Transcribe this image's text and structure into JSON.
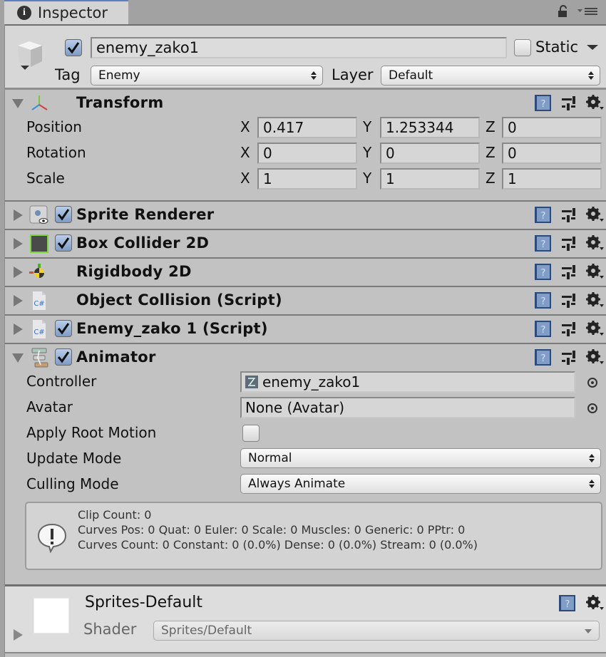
{
  "tab": {
    "title": "Inspector",
    "icon": "info-icon"
  },
  "tab_controls": {
    "lock": "lock-icon",
    "menu": "tab-menu-icon"
  },
  "gameobject": {
    "active": true,
    "name": "enemy_zako1",
    "static_label": "Static",
    "static": false,
    "tag_label": "Tag",
    "tag_value": "Enemy",
    "layer_label": "Layer",
    "layer_value": "Default"
  },
  "transform": {
    "title": "Transform",
    "expanded": true,
    "rows": [
      {
        "label": "Position",
        "x": "0.417",
        "y": "1.253344",
        "z": "0"
      },
      {
        "label": "Rotation",
        "x": "0",
        "y": "0",
        "z": "0"
      },
      {
        "label": "Scale",
        "x": "1",
        "y": "1",
        "z": "1"
      }
    ],
    "axis_labels": {
      "x": "X",
      "y": "Y",
      "z": "Z"
    }
  },
  "components": [
    {
      "title": "Sprite Renderer",
      "icon": "sprite-renderer-icon",
      "has_checkbox": true,
      "enabled": true,
      "expanded": false
    },
    {
      "title": "Box Collider 2D",
      "icon": "box-collider-icon",
      "has_checkbox": true,
      "enabled": true,
      "expanded": false
    },
    {
      "title": "Rigidbody 2D",
      "icon": "rigidbody-icon",
      "has_checkbox": false,
      "expanded": false
    },
    {
      "title": "Object Collision (Script)",
      "icon": "csharp-script-icon",
      "has_checkbox": false,
      "expanded": false
    },
    {
      "title": "Enemy_zako 1 (Script)",
      "icon": "csharp-script-icon",
      "has_checkbox": true,
      "enabled": true,
      "expanded": false
    }
  ],
  "animator": {
    "title": "Animator",
    "enabled": true,
    "expanded": true,
    "controller_label": "Controller",
    "controller_value": "enemy_zako1",
    "avatar_label": "Avatar",
    "avatar_value": "None (Avatar)",
    "apply_root_motion_label": "Apply Root Motion",
    "apply_root_motion": false,
    "update_mode_label": "Update Mode",
    "update_mode_value": "Normal",
    "culling_mode_label": "Culling Mode",
    "culling_mode_value": "Always Animate",
    "info_lines": [
      "Clip Count: 0",
      "Curves Pos: 0 Quat: 0 Euler: 0 Scale: 0 Muscles: 0 Generic: 0 PPtr: 0",
      "Curves Count: 0 Constant: 0 (0.0%) Dense: 0 (0.0%) Stream: 0 (0.0%)"
    ]
  },
  "material": {
    "name": "Sprites-Default",
    "shader_label": "Shader",
    "shader_value": "Sprites/Default"
  },
  "colors": {
    "tab_accent": "#5b7fbf",
    "panel_bg": "#c2c2c2",
    "header_bg": "#d7d7d7",
    "checkbox_blue": "#7d9bc7",
    "collider_green": "#7bd63f"
  }
}
